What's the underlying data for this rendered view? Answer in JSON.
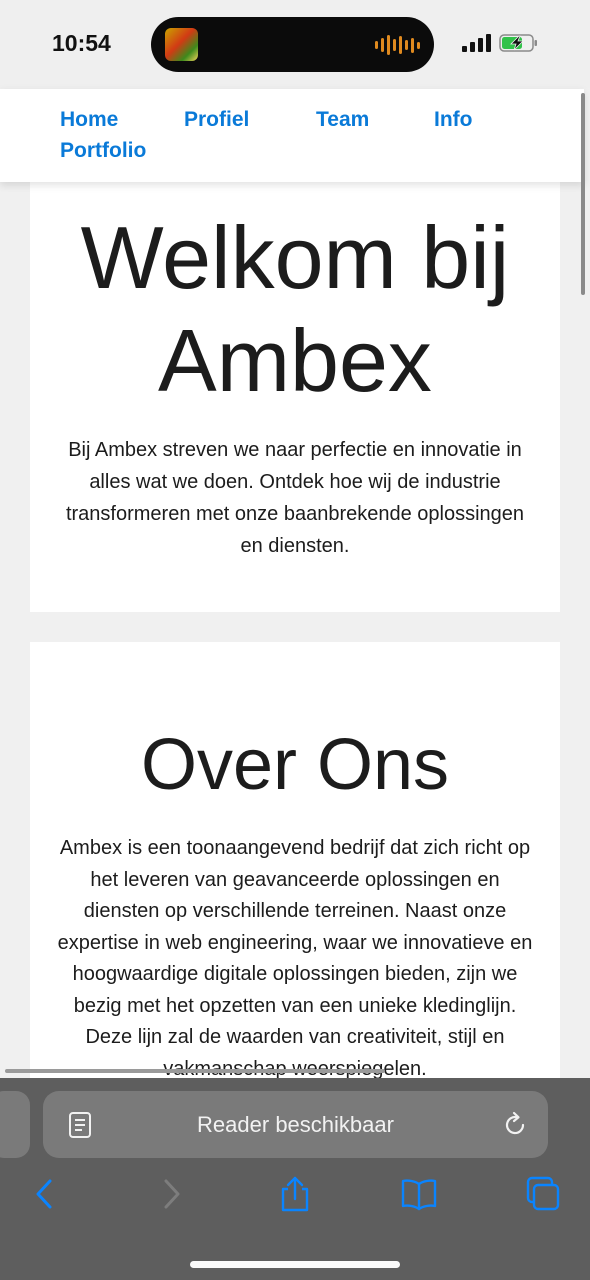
{
  "status_bar": {
    "time": "10:54"
  },
  "nav": {
    "items": [
      {
        "label": "Home"
      },
      {
        "label": "Profiel"
      },
      {
        "label": "Team"
      },
      {
        "label": "Info"
      },
      {
        "label": "Portfolio"
      }
    ],
    "link_color": "#0a7ad8"
  },
  "hero": {
    "title": "Welkom bij Ambex",
    "text": "Bij Ambex streven we naar perfectie en innovatie in alles wat we doen. Ontdek hoe wij de industrie transformeren met onze baanbrekende oplossingen en diensten."
  },
  "about": {
    "title": "Over Ons",
    "text": "Ambex is een toonaangevend bedrijf dat zich richt op het leveren van geavanceerde oplossingen en diensten op verschillende terreinen. Naast onze expertise in web engineering, waar we innovatieve en hoogwaardige digitale oplossingen bieden, zijn we bezig met het opzetten van een unieke kledinglijn. Deze lijn zal de waarden van creativiteit, stijl en vakmanschap weerspiegelen."
  },
  "safari": {
    "address_text": "Reader beschikbaar",
    "icons": {
      "reader": "reader-icon",
      "reload": "reload-icon",
      "back": "chevron-left-icon",
      "forward": "chevron-right-icon",
      "share": "share-icon",
      "bookmarks": "book-icon",
      "tabs": "tabs-icon"
    },
    "accent": "#0a84ff"
  }
}
